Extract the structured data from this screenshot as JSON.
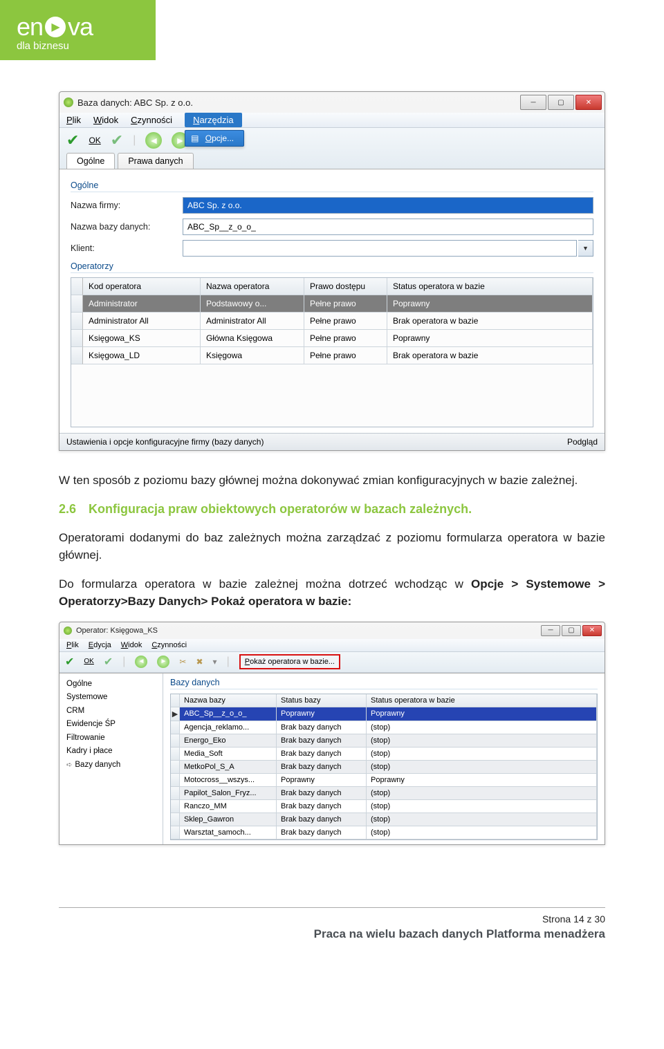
{
  "logo": {
    "brand1": "en",
    "brand2": "va",
    "sub": "dla biznesu"
  },
  "window1": {
    "title": "Baza danych: ABC Sp. z o.o.",
    "menu": {
      "plik": "Plik",
      "widok": "Widok",
      "czynnosci": "Czynności",
      "narzedzia": "Narzędzia",
      "opcje": "Opcje..."
    },
    "toolbar": {
      "ok": "OK"
    },
    "tabs": {
      "ogolne": "Ogólne",
      "prawa": "Prawa danych"
    },
    "group1": "Ogólne",
    "fields": {
      "nazwa_firmy_label": "Nazwa firmy:",
      "nazwa_firmy_val": "ABC Sp. z o.o.",
      "nazwa_bazy_label": "Nazwa bazy danych:",
      "nazwa_bazy_val": "ABC_Sp__z_o_o_",
      "klient_label": "Klient:",
      "klient_val": ""
    },
    "group2": "Operatorzy",
    "grid_headers": {
      "kod": "Kod operatora",
      "nazwa": "Nazwa operatora",
      "prawo": "Prawo dostępu",
      "status": "Status operatora w bazie"
    },
    "rows": [
      {
        "kod": "Administrator",
        "nazwa": "Podstawowy o...",
        "prawo": "Pełne prawo",
        "status": "Poprawny"
      },
      {
        "kod": "Administrator All",
        "nazwa": "Administrator All",
        "prawo": "Pełne prawo",
        "status": "Brak operatora w bazie"
      },
      {
        "kod": "Księgowa_KS",
        "nazwa": "Główna Księgowa",
        "prawo": "Pełne prawo",
        "status": "Poprawny"
      },
      {
        "kod": "Księgowa_LD",
        "nazwa": "Księgowa",
        "prawo": "Pełne prawo",
        "status": "Brak operatora w bazie"
      }
    ],
    "status_left": "Ustawienia i opcje konfiguracyjne firmy (bazy danych)",
    "status_right": "Podgląd"
  },
  "doc": {
    "p1": "W ten sposób z poziomu bazy głównej można dokonywać zmian konfiguracyjnych w bazie zależnej.",
    "h_num": "2.6",
    "h_txt": "Konfiguracja praw obiektowych operatorów w bazach zależnych.",
    "p2": "Operatorami dodanymi do baz zależnych można zarządzać z poziomu formularza operatora w bazie głównej.",
    "p3a": "Do formularza operatora w bazie zależnej można dotrzeć wchodząc w ",
    "p3b": "Opcje > Systemowe > Operatorzy>Bazy Danych> Pokaż operatora w bazie:"
  },
  "window2": {
    "title": "Operator: Księgowa_KS",
    "menu": {
      "plik": "Plik",
      "edycja": "Edycja",
      "widok": "Widok",
      "czynnosci": "Czynności"
    },
    "toolbar": {
      "ok": "OK",
      "action": "Pokaż operatora w bazie..."
    },
    "tree": [
      "Ogólne",
      "Systemowe",
      "CRM",
      "Ewidencje ŚP",
      "Filtrowanie",
      "Kadry i płace",
      "Bazy danych"
    ],
    "group": "Bazy danych",
    "grid_headers": {
      "nazwa": "Nazwa bazy",
      "status": "Status bazy",
      "statop": "Status operatora w bazie"
    },
    "rows": [
      {
        "nazwa": "ABC_Sp__z_o_o_",
        "status": "Poprawny",
        "statop": "Poprawny"
      },
      {
        "nazwa": "Agencja_reklamo...",
        "status": "Brak bazy danych",
        "statop": "(stop)"
      },
      {
        "nazwa": "Energo_Eko",
        "status": "Brak bazy danych",
        "statop": "(stop)"
      },
      {
        "nazwa": "Media_Soft",
        "status": "Brak bazy danych",
        "statop": "(stop)"
      },
      {
        "nazwa": "MetkoPol_S_A",
        "status": "Brak bazy danych",
        "statop": "(stop)"
      },
      {
        "nazwa": "Motocross__wszys...",
        "status": "Poprawny",
        "statop": "Poprawny"
      },
      {
        "nazwa": "Papilot_Salon_Fryz...",
        "status": "Brak bazy danych",
        "statop": "(stop)"
      },
      {
        "nazwa": "Ranczo_MM",
        "status": "Brak bazy danych",
        "statop": "(stop)"
      },
      {
        "nazwa": "Sklep_Gawron",
        "status": "Brak bazy danych",
        "statop": "(stop)"
      },
      {
        "nazwa": "Warsztat_samoch...",
        "status": "Brak bazy danych",
        "statop": "(stop)"
      }
    ]
  },
  "footer": {
    "page": "Strona 14 z 30",
    "title": "Praca na wielu bazach danych Platforma menadżera"
  }
}
